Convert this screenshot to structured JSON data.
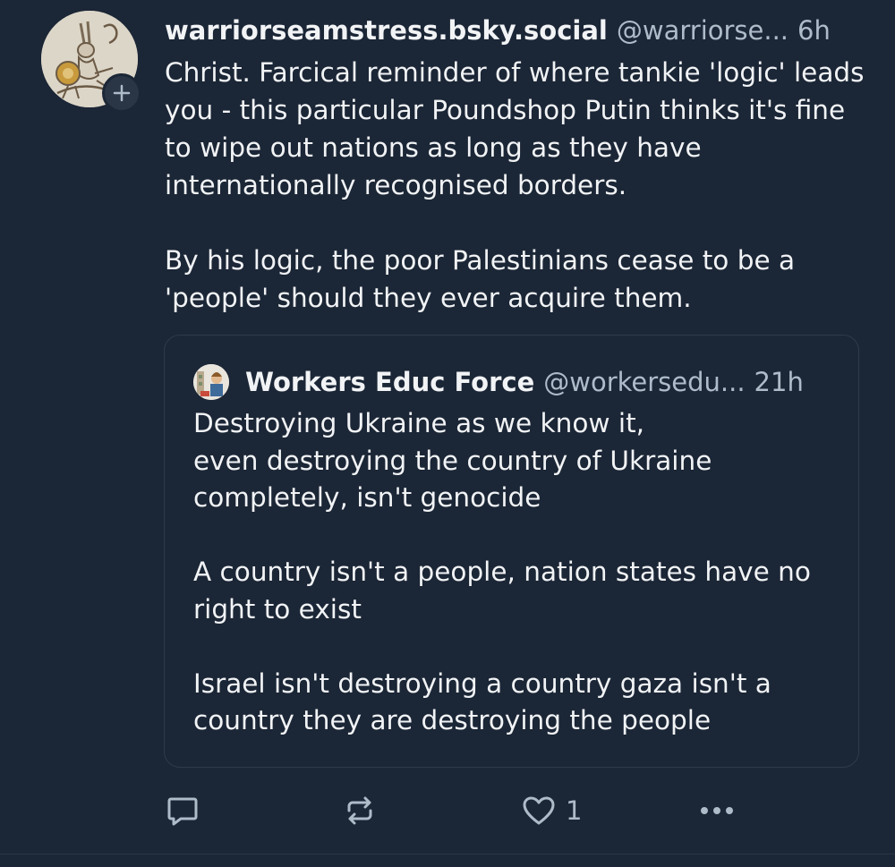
{
  "post": {
    "author": {
      "display_name": "warriorseamstress.bsky.social",
      "handle": "@warriorse...",
      "avatar_icon": "medieval-hare-knight-avatar"
    },
    "time": "6h",
    "follow_icon": "plus-icon",
    "text": {
      "paragraph1": "Christ. Farcical reminder of where tankie 'logic' leads you - this particular Poundshop Putin thinks it's fine to wipe out nations as long as they have internationally recognised borders.",
      "paragraph2": "By his logic, the poor Palestinians cease to be a 'people' should they ever acquire them."
    }
  },
  "quote": {
    "author": {
      "display_name": "Workers Educ Force",
      "handle": "@workersedu...",
      "avatar_icon": "illustration-avatar"
    },
    "time": "21h",
    "text": {
      "line1": "Destroying Ukraine as we know it,",
      "line2": "even destroying the country of Ukraine",
      "line3": "completely, isn't genocide",
      "paragraph2": "A country isn't a people, nation states have no right to exist",
      "paragraph3": "Israel isn't destroying a country gaza isn't a country they are destroying the people"
    }
  },
  "actions": {
    "reply_icon": "reply-bubble-icon",
    "repost_icon": "repost-arrows-icon",
    "like_icon": "heart-icon",
    "like_count": "1",
    "more_icon": "ellipsis-icon"
  },
  "colors": {
    "background": "#1b2636",
    "text": "#f1f3f5",
    "muted": "#aebbc9",
    "border": "#2f3b4c"
  }
}
